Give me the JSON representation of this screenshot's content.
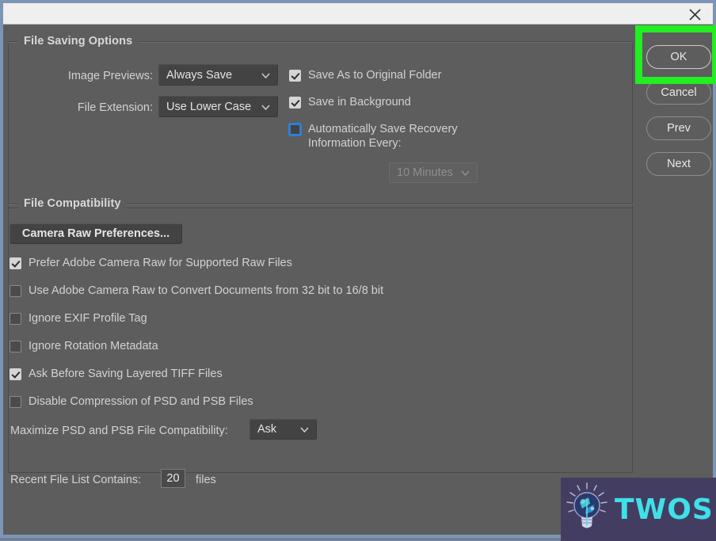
{
  "window": {
    "close_icon": "close-icon"
  },
  "file_saving": {
    "group_title": "File Saving Options",
    "image_previews_label": "Image Previews:",
    "image_previews_value": "Always Save",
    "file_extension_label": "File Extension:",
    "file_extension_value": "Use Lower Case",
    "save_as_original_label": "Save As to Original Folder",
    "save_as_original_checked": true,
    "save_background_label": "Save in Background",
    "save_background_checked": true,
    "auto_recovery_label": "Automatically Save Recovery\nInformation Every:",
    "auto_recovery_checked": false,
    "recovery_interval_value": "10 Minutes",
    "recovery_interval_disabled": true
  },
  "file_compat": {
    "group_title": "File Compatibility",
    "camera_raw_button": "Camera Raw Preferences...",
    "checkboxes": [
      {
        "label": "Prefer Adobe Camera Raw for Supported Raw Files",
        "checked": true
      },
      {
        "label": "Use Adobe Camera Raw to Convert Documents from 32 bit to 16/8 bit",
        "checked": false
      },
      {
        "label": "Ignore EXIF Profile Tag",
        "checked": false
      },
      {
        "label": "Ignore Rotation Metadata",
        "checked": false
      },
      {
        "label": "Ask Before Saving Layered TIFF Files",
        "checked": true
      },
      {
        "label": "Disable Compression of PSD and PSB Files",
        "checked": false
      }
    ],
    "maximize_label": "Maximize PSD and PSB File Compatibility:",
    "maximize_value": "Ask"
  },
  "recent_files": {
    "label": "Recent File List Contains:",
    "value": "20",
    "suffix": "files"
  },
  "buttons": {
    "ok": "OK",
    "cancel": "Cancel",
    "prev": "Prev",
    "next": "Next"
  },
  "watermark": {
    "text": "TWOS"
  },
  "colors": {
    "dialog_bg": "#5d5d5d",
    "titlebar_bg": "#efefef",
    "window_border": "#7c95b4",
    "field_bg": "#434343",
    "text": "#d2d2d2",
    "highlight_green": "#22ee22",
    "watermark_bg": "#433e61",
    "watermark_text": "#3fe0e8",
    "focus_blue": "#2f7fd4"
  }
}
